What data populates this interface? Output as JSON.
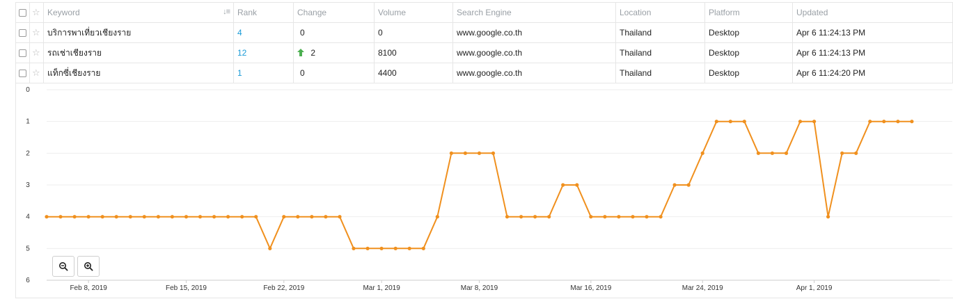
{
  "table": {
    "headers": {
      "keyword": "Keyword",
      "rank": "Rank",
      "change": "Change",
      "volume": "Volume",
      "search_engine": "Search Engine",
      "location": "Location",
      "platform": "Platform",
      "updated": "Updated"
    },
    "rows": [
      {
        "keyword": "บริการพาเที่ยวเชียงราย",
        "rank": "4",
        "change": "0",
        "change_up": false,
        "volume": "0",
        "search_engine": "www.google.co.th",
        "location": "Thailand",
        "platform": "Desktop",
        "updated": "Apr 6 11:24:13 PM"
      },
      {
        "keyword": "รถเช่าเชียงราย",
        "rank": "12",
        "change": "2",
        "change_up": true,
        "volume": "8100",
        "search_engine": "www.google.co.th",
        "location": "Thailand",
        "platform": "Desktop",
        "updated": "Apr 6 11:24:13 PM"
      },
      {
        "keyword": "แท็กซี่เชียงราย",
        "rank": "1",
        "change": "0",
        "change_up": false,
        "volume": "4400",
        "search_engine": "www.google.co.th",
        "location": "Thailand",
        "platform": "Desktop",
        "updated": "Apr 6 11:24:20 PM"
      }
    ]
  },
  "icons": {
    "checkbox": "checkbox-icon",
    "star": "star-icon",
    "sort": "sort-icon",
    "up_arrow": "arrow-up-icon",
    "zoom_out": "zoom-out-icon",
    "zoom_in": "zoom-in-icon"
  },
  "colors": {
    "line": "#f0901e",
    "rank_link": "#1a9bd7",
    "up_arrow": "#4caf50",
    "grid": "#eeeeee"
  },
  "chart_data": {
    "type": "line",
    "title": "",
    "xlabel": "",
    "ylabel": "",
    "y_reversed": true,
    "ylim": [
      0,
      6
    ],
    "yticks": [
      "0",
      "1",
      "2",
      "3",
      "4",
      "5",
      "6"
    ],
    "xlim": [
      "2019-02-05",
      "2019-04-10"
    ],
    "xticks": [
      {
        "date": "2019-02-08",
        "label": "Feb 8, 2019"
      },
      {
        "date": "2019-02-15",
        "label": "Feb 15, 2019"
      },
      {
        "date": "2019-02-22",
        "label": "Feb 22, 2019"
      },
      {
        "date": "2019-03-01",
        "label": "Mar 1, 2019"
      },
      {
        "date": "2019-03-08",
        "label": "Mar 8, 2019"
      },
      {
        "date": "2019-03-16",
        "label": "Mar 16, 2019"
      },
      {
        "date": "2019-03-24",
        "label": "Mar 24, 2019"
      },
      {
        "date": "2019-04-01",
        "label": "Apr 1, 2019"
      }
    ],
    "grid": true,
    "series": [
      {
        "x": [
          "2019-02-05",
          "2019-02-06",
          "2019-02-07",
          "2019-02-08",
          "2019-02-09",
          "2019-02-10",
          "2019-02-11",
          "2019-02-12",
          "2019-02-13",
          "2019-02-14",
          "2019-02-15",
          "2019-02-16",
          "2019-02-17",
          "2019-02-18",
          "2019-02-19",
          "2019-02-20",
          "2019-02-21",
          "2019-02-22",
          "2019-02-23",
          "2019-02-24",
          "2019-02-25",
          "2019-02-26",
          "2019-02-27",
          "2019-02-28",
          "2019-03-01",
          "2019-03-02",
          "2019-03-03",
          "2019-03-04",
          "2019-03-05",
          "2019-03-06",
          "2019-03-07",
          "2019-03-08",
          "2019-03-09",
          "2019-03-10",
          "2019-03-11",
          "2019-03-12",
          "2019-03-13",
          "2019-03-14",
          "2019-03-15",
          "2019-03-16",
          "2019-03-17",
          "2019-03-18",
          "2019-03-19",
          "2019-03-20",
          "2019-03-21",
          "2019-03-22",
          "2019-03-23",
          "2019-03-24",
          "2019-03-25",
          "2019-03-26",
          "2019-03-27",
          "2019-03-28",
          "2019-03-29",
          "2019-03-30",
          "2019-03-31",
          "2019-04-01",
          "2019-04-02",
          "2019-04-03",
          "2019-04-04",
          "2019-04-05",
          "2019-04-06",
          "2019-04-07",
          "2019-04-08"
        ],
        "values": [
          4,
          4,
          4,
          4,
          4,
          4,
          4,
          4,
          4,
          4,
          4,
          4,
          4,
          4,
          4,
          4,
          5,
          4,
          4,
          4,
          4,
          4,
          5,
          5,
          5,
          5,
          5,
          5,
          4,
          2,
          2,
          2,
          2,
          4,
          4,
          4,
          4,
          3,
          3,
          4,
          4,
          4,
          4,
          4,
          4,
          3,
          3,
          2,
          1,
          1,
          1,
          2,
          2,
          2,
          1,
          1,
          4,
          2,
          2,
          1,
          1,
          1,
          1
        ]
      }
    ]
  }
}
